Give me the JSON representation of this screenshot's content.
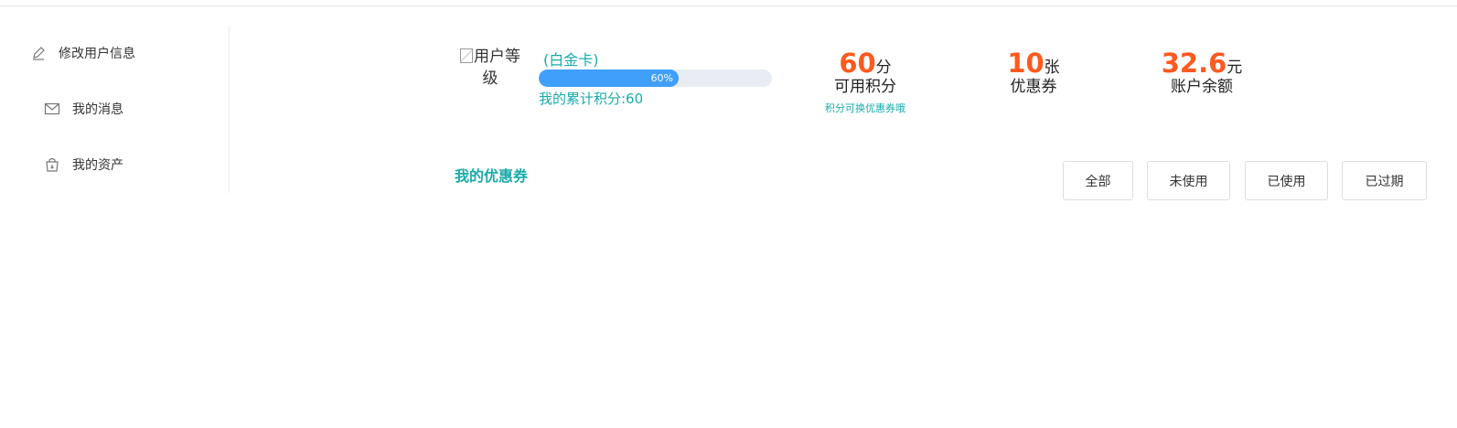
{
  "sidebar": {
    "items": [
      {
        "label": "修改用户信息",
        "icon": "pencil-icon"
      },
      {
        "label": "我的消息",
        "icon": "envelope-icon"
      },
      {
        "label": "我的资产",
        "icon": "bag-icon"
      }
    ]
  },
  "profile": {
    "level_image_alt": "用户等级",
    "card_name": "(白金卡)",
    "progress_percent": 60,
    "progress_label": "60%",
    "total_points_label": "我的累计积分:60"
  },
  "stats": [
    {
      "value": "60",
      "unit": "分",
      "label": "可用积分",
      "hint": "积分可换优惠券哦"
    },
    {
      "value": "10",
      "unit": "张",
      "label": "优惠券",
      "hint": ""
    },
    {
      "value": "32.6",
      "unit": "元",
      "label": "账户余额",
      "hint": ""
    }
  ],
  "coupons": {
    "title": "我的优惠券",
    "filters": [
      "全部",
      "未使用",
      "已使用",
      "已过期"
    ]
  },
  "colors": {
    "accent": "#1aabab",
    "highlight": "#ff5a1f",
    "progress": "#3f9ffb"
  }
}
